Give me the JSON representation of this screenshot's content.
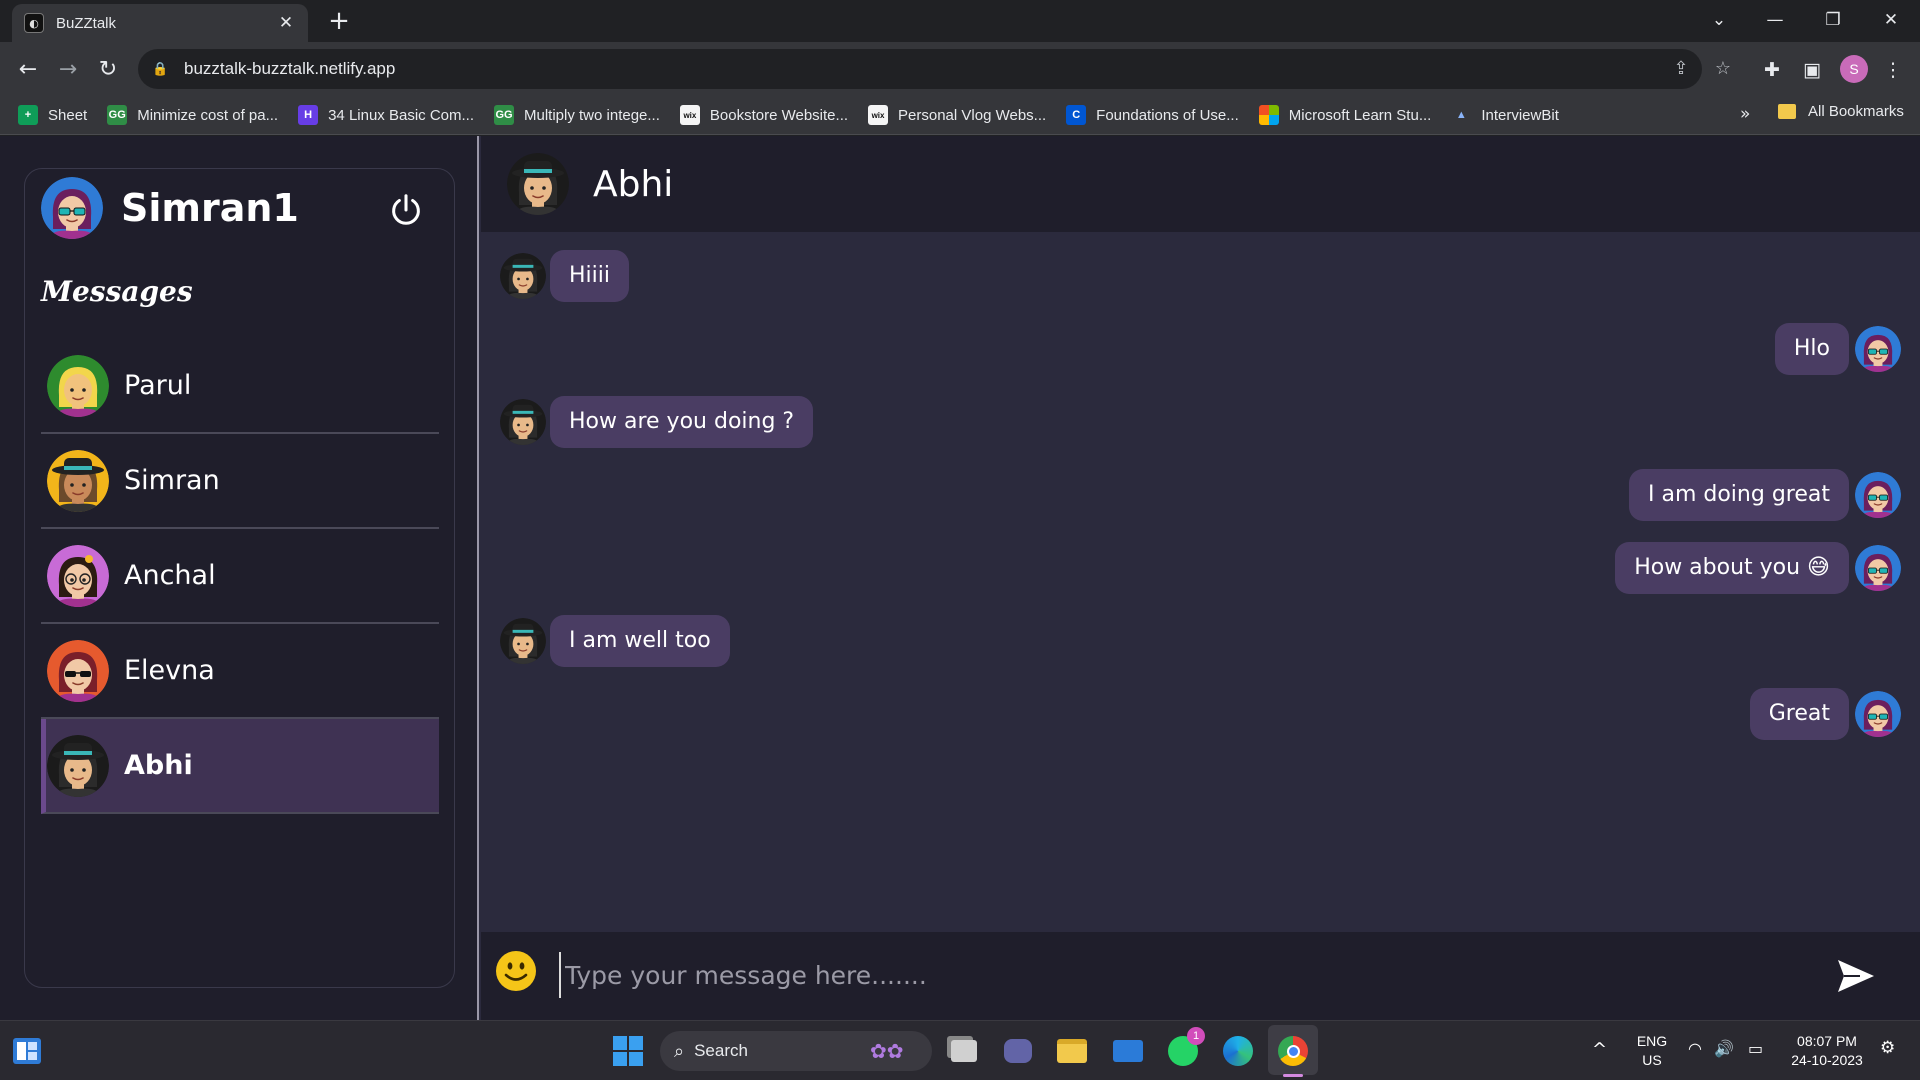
{
  "browser": {
    "tab_title": "BuZZtalk",
    "tab_favicon": "buzztalk-logo-icon",
    "url": "buzztalk-buzztalk.netlify.app",
    "profile_initial": "S",
    "bookmarks": [
      {
        "label": "Sheet",
        "icon": "sheets-icon",
        "color": "#0f9d58",
        "glyph": "+"
      },
      {
        "label": "Minimize cost of pa...",
        "icon": "geeksforgeeks-icon",
        "color": "#2f8d46",
        "glyph": "GG"
      },
      {
        "label": "34 Linux Basic Com...",
        "icon": "hostinger-icon",
        "color": "#673de6",
        "glyph": "H"
      },
      {
        "label": "Multiply two intege...",
        "icon": "geeksforgeeks-icon",
        "color": "#2f8d46",
        "glyph": "GG"
      },
      {
        "label": "Bookstore Website...",
        "icon": "wix-icon",
        "color": "#f5f5f5",
        "glyph": "wix"
      },
      {
        "label": "Personal Vlog Webs...",
        "icon": "wix-icon",
        "color": "#f5f5f5",
        "glyph": "wix"
      },
      {
        "label": "Foundations of Use...",
        "icon": "coursera-icon",
        "color": "#0056d2",
        "glyph": "C"
      },
      {
        "label": "Microsoft Learn Stu...",
        "icon": "microsoft-icon",
        "color": "#f25022",
        "glyph": ""
      },
      {
        "label": "InterviewBit",
        "icon": "interviewbit-icon",
        "color": "#35363a",
        "glyph": "▲"
      }
    ],
    "bookmarks_more": "»",
    "all_bookmarks": "All Bookmarks"
  },
  "app": {
    "current_user": "Simran1",
    "messages_heading": "Messages",
    "contacts": [
      {
        "name": "Parul",
        "avatar": "parul-avatar",
        "bg": "#2e8b2e",
        "skin": "#f1c27d",
        "hair": "#f2d64b"
      },
      {
        "name": "Simran",
        "avatar": "simran-avatar",
        "bg": "#f2b51a",
        "skin": "#c98a5a",
        "hair": "#6b4a2b"
      },
      {
        "name": "Anchal",
        "avatar": "anchal-avatar",
        "bg": "#c86bd6",
        "skin": "#f1c9a6",
        "hair": "#2b1b12"
      },
      {
        "name": "Elevna",
        "avatar": "elevna-avatar",
        "bg": "#e65a2e",
        "skin": "#f1c9a6",
        "hair": "#7a1f2a"
      },
      {
        "name": "Abhi",
        "avatar": "abhi-avatar",
        "bg": "#1b1b1b",
        "skin": "#e8b98a",
        "hair": "#2b2b2b",
        "active": true
      }
    ],
    "chat": {
      "partner": "Abhi",
      "messages": [
        {
          "text": "Hiiii",
          "direction": "in"
        },
        {
          "text": "Hlo",
          "direction": "out"
        },
        {
          "text": "How are you doing ?",
          "direction": "in"
        },
        {
          "text": "I am doing great",
          "direction": "out"
        },
        {
          "text": "How about you 😅",
          "direction": "out"
        },
        {
          "text": "I am well too",
          "direction": "in"
        },
        {
          "text": "Great",
          "direction": "out"
        }
      ],
      "input_placeholder": "Type your message here.......",
      "input_value": ""
    }
  },
  "taskbar": {
    "search_label": "Search",
    "whatsapp_badge": "1",
    "lang_line1": "ENG",
    "lang_line2": "US",
    "time": "08:07 PM",
    "date": "24-10-2023"
  },
  "colors": {
    "bubble": "#4a3d63",
    "sidebar_bg": "#1f1e2b",
    "chat_bg": "#2b2a3d",
    "active_contact": "#3f3253"
  }
}
